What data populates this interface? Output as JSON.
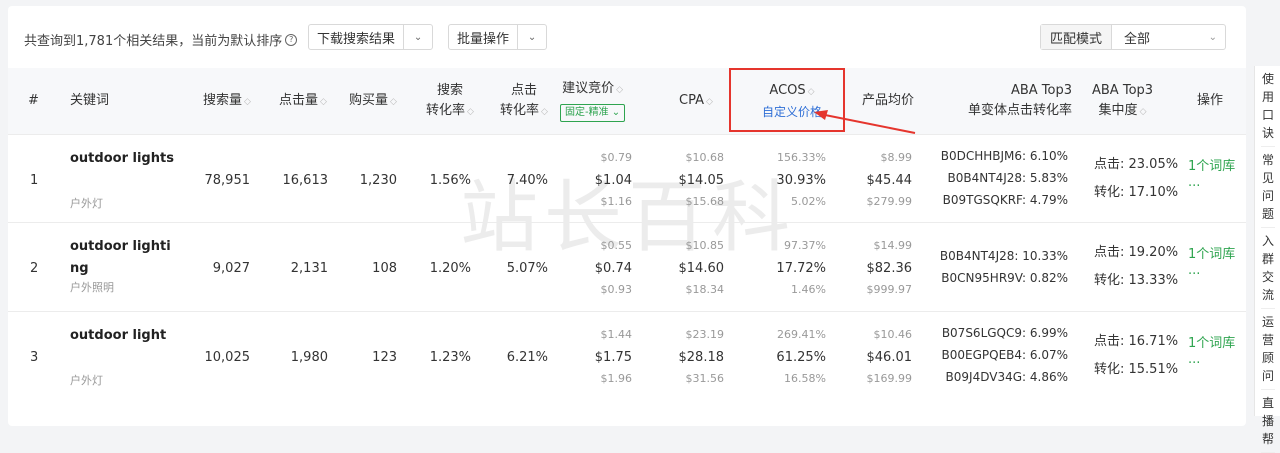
{
  "toolbar": {
    "summary": "共查询到1,781个相关结果，当前为默认排序",
    "download_label": "下载搜索结果",
    "batch_label": "批量操作",
    "match_mode_label": "匹配模式",
    "match_mode_value": "全部"
  },
  "headers": {
    "index": "#",
    "keyword": "关键词",
    "search_volume": "搜索量",
    "clicks": "点击量",
    "purchases": "购买量",
    "search_cvr_1": "搜索",
    "search_cvr_2": "转化率",
    "click_cvr_1": "点击",
    "click_cvr_2": "转化率",
    "bid": "建议竞价",
    "bid_tag": "固定-精准",
    "cpa": "CPA",
    "acos": "ACOS",
    "acos_sub": "自定义价格",
    "avg_price": "产品均价",
    "aba_1": "ABA Top3",
    "aba_2": "单变体点击转化率",
    "aba_conc_1": "ABA Top3",
    "aba_conc_2": "集中度",
    "ops": "操作"
  },
  "rows": [
    {
      "index": "1",
      "keyword": "outdoor lights",
      "keyword_cn": "户外灯",
      "search_volume": "78,951",
      "clicks": "16,613",
      "purchases": "1,230",
      "search_cvr": "1.56%",
      "click_cvr": "7.40%",
      "bid": {
        "low": "$0.79",
        "mid": "$1.04",
        "high": "$1.16"
      },
      "cpa": {
        "low": "$10.68",
        "mid": "$14.05",
        "high": "$15.68"
      },
      "acos": {
        "low": "156.33%",
        "mid": "30.93%",
        "high": "5.02%"
      },
      "price": {
        "low": "$8.99",
        "mid": "$45.44",
        "high": "$279.99"
      },
      "aba": [
        "B0DCHHBJM6: 6.10%",
        "B0B4NT4J28: 5.83%",
        "B09TGSQKRF: 4.79%"
      ],
      "conc_click": "点击: 23.05%",
      "conc_conv": "转化: 17.10%",
      "op": "1个词库",
      "more": "···"
    },
    {
      "index": "2",
      "keyword": "outdoor lighti",
      "keyword2": "ng",
      "keyword_cn": "户外照明",
      "search_volume": "9,027",
      "clicks": "2,131",
      "purchases": "108",
      "search_cvr": "1.20%",
      "click_cvr": "5.07%",
      "bid": {
        "low": "$0.55",
        "mid": "$0.74",
        "high": "$0.93"
      },
      "cpa": {
        "low": "$10.85",
        "mid": "$14.60",
        "high": "$18.34"
      },
      "acos": {
        "low": "97.37%",
        "mid": "17.72%",
        "high": "1.46%"
      },
      "price": {
        "low": "$14.99",
        "mid": "$82.36",
        "high": "$999.97"
      },
      "aba": [
        "B0B4NT4J28: 10.33%",
        "B0CN95HR9V: 0.82%"
      ],
      "conc_click": "点击: 19.20%",
      "conc_conv": "转化: 13.33%",
      "op": "1个词库",
      "more": "···"
    },
    {
      "index": "3",
      "keyword": "outdoor light",
      "keyword_cn": "户外灯",
      "search_volume": "10,025",
      "clicks": "1,980",
      "purchases": "123",
      "search_cvr": "1.23%",
      "click_cvr": "6.21%",
      "bid": {
        "low": "$1.44",
        "mid": "$1.75",
        "high": "$1.96"
      },
      "cpa": {
        "low": "$23.19",
        "mid": "$28.18",
        "high": "$31.56"
      },
      "acos": {
        "low": "269.41%",
        "mid": "61.25%",
        "high": "16.58%"
      },
      "price": {
        "low": "$10.46",
        "mid": "$46.01",
        "high": "$169.99"
      },
      "aba": [
        "B07S6LGQC9: 6.99%",
        "B00EGPQEB4: 6.07%",
        "B09J4DV34G: 4.86%"
      ],
      "conc_click": "点击: 16.71%",
      "conc_conv": "转化: 15.51%",
      "op": "1个词库",
      "more": "···"
    }
  ],
  "sidebar": [
    "使用口诀",
    "常见问题",
    "入群交流",
    "运营顾问",
    "直播帮"
  ],
  "watermark": "站长百科",
  "colors": {
    "accent_green": "#2ea44f",
    "link_blue": "#2f6fd6",
    "highlight_red": "#e5352d"
  }
}
